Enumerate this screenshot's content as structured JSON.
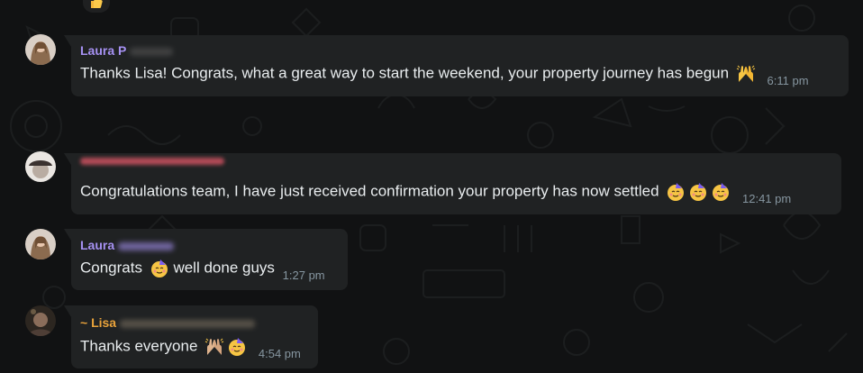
{
  "top_reaction": {
    "icon": "thumbs-up-icon"
  },
  "messages": [
    {
      "sender": "Laura P",
      "sender_color": "#a691f2",
      "text": "Thanks Lisa! Congrats, what a great way to start the weekend, your property journey has begun",
      "emojis": [
        "raising-hands-icon"
      ],
      "time": "6:11 pm"
    },
    {
      "sender": "",
      "sender_color": "#f15c6d",
      "text": "Congratulations team, I have just received confirmation your property has now settled",
      "emojis": [
        "partying-face-icon",
        "partying-face-icon",
        "partying-face-icon"
      ],
      "time": "12:41 pm"
    },
    {
      "sender": "Laura",
      "sender_color": "#a691f2",
      "text_before": "Congrats",
      "emojis": [
        "partying-face-icon"
      ],
      "text_after": "well done guys",
      "time": "1:27 pm"
    },
    {
      "sender": "~ Lisa",
      "sender_color": "#e9a33b",
      "text": "Thanks everyone",
      "emojis": [
        "raising-hands-icon",
        "partying-face-icon"
      ],
      "time": "4:54 pm"
    }
  ]
}
